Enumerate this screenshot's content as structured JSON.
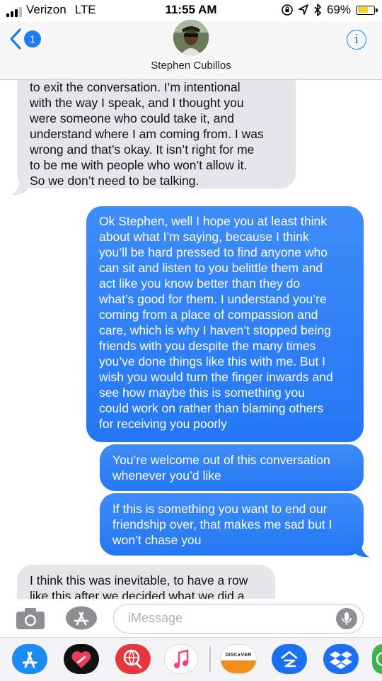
{
  "status_bar": {
    "carrier": "Verizon",
    "network": "LTE",
    "time": "11:55 AM",
    "battery_percent": "69%",
    "battery_level": 0.69
  },
  "header": {
    "back_badge": "1",
    "contact_name": "Stephen Cubillos",
    "info_label": "i"
  },
  "messages": [
    {
      "direction": "received",
      "lines": [
        "to exit the conversation. I’m intentional",
        "with the way I speak, and I thought you",
        "were someone who could take it, and",
        "understand where I am coming from. I was",
        "wrong and that’s okay. It isn’t right for me",
        "to be me with people who won’t allow it.",
        "So we don’t need to be talking."
      ]
    },
    {
      "direction": "sent",
      "lines": [
        "Ok Stephen, well I hope you at least think",
        "about what I’m saying, because I think",
        "you’ll be hard pressed to find anyone who",
        "can sit and listen to you belittle them and",
        "act like you know better than they do",
        "what’s good for them. I understand you’re",
        "coming from a place of compassion and",
        "care, which is why I haven’t stopped being",
        "friends with you despite the many times",
        "you’ve done things like this with me. But I",
        "wish you would turn the finger inwards and",
        "see how maybe this is something you",
        "could work on rather than blaming others",
        "for receiving you poorly"
      ]
    },
    {
      "direction": "sent",
      "lines": [
        "You’re welcome out of this conversation",
        "whenever you’d like"
      ]
    },
    {
      "direction": "sent",
      "lines": [
        "If this is something you want to end our",
        "friendship over, that makes me sad but I",
        "won’t chase you"
      ]
    },
    {
      "direction": "received",
      "lines": [
        "I think this was inevitable, to have a row",
        "like this after we decided what we did a"
      ]
    }
  ],
  "input_bar": {
    "placeholder": "iMessage"
  },
  "app_drawer": {
    "apps": [
      {
        "name": "app-store-app",
        "icon": "app-store-icon",
        "color": "#1a8cf3"
      },
      {
        "name": "digital-touch-app",
        "icon": "heart-icon",
        "color": "#111111"
      },
      {
        "name": "web-images-app",
        "icon": "globe-search-icon",
        "color": "#e8373c"
      },
      {
        "name": "music-app",
        "icon": "music-note-icon",
        "color": "#ffffff"
      },
      {
        "name": "discover-app",
        "icon": "discover-icon",
        "color": "#ffffff",
        "label": "DISC●VER"
      },
      {
        "name": "zillow-app",
        "icon": "zillow-icon",
        "color": "#1b6ff2"
      },
      {
        "name": "dropbox-app",
        "icon": "dropbox-icon",
        "color": "#1b6ff2"
      },
      {
        "name": "partial-app",
        "icon": "partial-app-icon",
        "color": "#3ab54a"
      }
    ]
  }
}
